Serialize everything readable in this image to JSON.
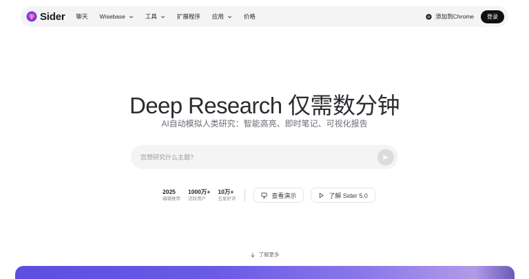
{
  "brand": {
    "name": "Sider"
  },
  "nav": {
    "items": [
      {
        "label": "聊天",
        "has_dropdown": false
      },
      {
        "label": "Wisebase",
        "has_dropdown": true
      },
      {
        "label": "工具",
        "has_dropdown": true
      },
      {
        "label": "扩展程序",
        "has_dropdown": false
      },
      {
        "label": "应用",
        "has_dropdown": true
      },
      {
        "label": "价格",
        "has_dropdown": false
      }
    ],
    "chrome_label": "添加到Chrome",
    "login_label": "登录"
  },
  "hero": {
    "title": "Deep Research 仅需数分钟",
    "subtitle": "AI自动模拟人类研究：智能高亮、即时笔记、可视化报告"
  },
  "search": {
    "placeholder": "您想研究什么主题?"
  },
  "stats": [
    {
      "value": "2025",
      "label": "编辑推荐"
    },
    {
      "value": "1000万+",
      "label": "活跃用户"
    },
    {
      "value": "10万+",
      "label": "五星好评"
    }
  ],
  "actions": {
    "demo_label": "查看演示",
    "learn_sider_label": "了解 Sider 5.0"
  },
  "learn_more": "了解更多",
  "colors": {
    "accent": "#5b4fe0",
    "login_bg": "#0f0f14",
    "nav_bg": "#f4f4f5"
  }
}
